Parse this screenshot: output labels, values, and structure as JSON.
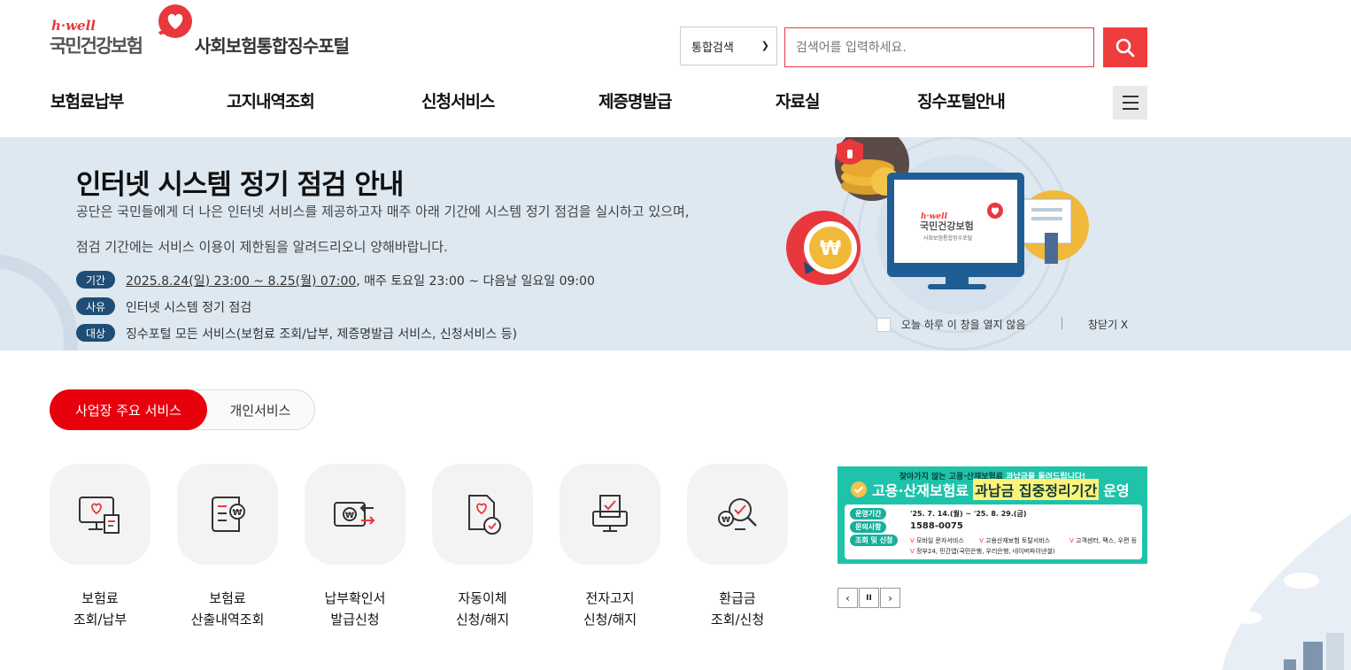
{
  "header": {
    "logo_en": "h·well",
    "logo_ko": "국민건강보험",
    "portal_title": "사회보험통합징수포털"
  },
  "search": {
    "scope": "통합검색",
    "placeholder": "검색어를 입력하세요."
  },
  "nav": {
    "items": [
      {
        "label": "보험료납부"
      },
      {
        "label": "고지내역조회"
      },
      {
        "label": "신청서비스"
      },
      {
        "label": "제증명발급"
      },
      {
        "label": "자료실"
      },
      {
        "label": "징수포털안내"
      }
    ]
  },
  "notice": {
    "title": "인터넷 시스템 정기 점검 안내",
    "desc_line1": "공단은 국민들에게 더 나은 인터넷 서비스를 제공하고자 매주 아래 기간에 시스템 정기 점검을 실시하고 있으며,",
    "desc_line2": "점검 기간에는 서비스 이용이 제한됨을 알려드리오니 양해바랍니다.",
    "rows": [
      {
        "tag": "기간",
        "text_underlined": "2025.8.24(일) 23:00 ~ 8.25(월) 07:00",
        "text": ", 매주 토요일 23:00 ~ 다음날 일요일 09:00"
      },
      {
        "tag": "사유",
        "text_underlined": "",
        "text": "인터넷 시스템 정기 점검"
      },
      {
        "tag": "대상",
        "text_underlined": "",
        "text": "징수포털 모든 서비스(보험료 조회/납부, 제증명발급 서비스, 신청서비스 등)"
      }
    ],
    "illustration": {
      "logo_en": "h·well",
      "logo_ko": "국민건강보험",
      "logo_sub": "사회보험통합징수포털"
    },
    "no_show_today": "오늘 하루 이 창을 열지 않음",
    "close": "창닫기 X"
  },
  "service_tabs": {
    "active": "사업장 주요 서비스",
    "inactive": "개인서비스"
  },
  "services": [
    {
      "line1": "보험료",
      "line2": "조회/납부",
      "icon": "monitor-receipt-icon"
    },
    {
      "line1": "보험료",
      "line2": "산출내역조회",
      "icon": "document-won-icon"
    },
    {
      "line1": "납부확인서",
      "line2": "발급신청",
      "icon": "card-won-arrow-icon"
    },
    {
      "line1": "자동이체",
      "line2": "신청/해지",
      "icon": "document-check-icon"
    },
    {
      "line1": "전자고지",
      "line2": "신청/해지",
      "icon": "printer-check-icon"
    },
    {
      "line1": "환급금",
      "line2": "조회/신청",
      "icon": "magnifier-won-icon"
    }
  ],
  "promo": {
    "top_a": "찾아가지 않는 고용·산재보험료 ",
    "top_hl": "과납금을 돌려드립니다!",
    "title_a": "고용·산재보험료",
    "title_hl": "과납금 집중정리기간",
    "title_b": "운영",
    "period_label": "운영기간",
    "period": "'25. 7. 14.(월) ~ '25. 8. 29.(금)",
    "contact_label": "문의사항",
    "contact": "1588-0075",
    "apply_label": "조회 및 신청",
    "apply_items": [
      "모바일 문자서비스",
      "고용산재보험 토탈서비스",
      "고객센터, 팩스, 우편 등"
    ],
    "apply_item4": "정부24, 민간앱(국민은행, 우리은행, 네이버파이낸셜)",
    "controls": {
      "prev": "‹",
      "pause": "II",
      "next": "›"
    }
  },
  "colors": {
    "brand_red": "#e8383d",
    "tag_navy": "#1f4d75",
    "banner_bg": "#dde8f1",
    "promo_green": "#1ec3a9"
  }
}
